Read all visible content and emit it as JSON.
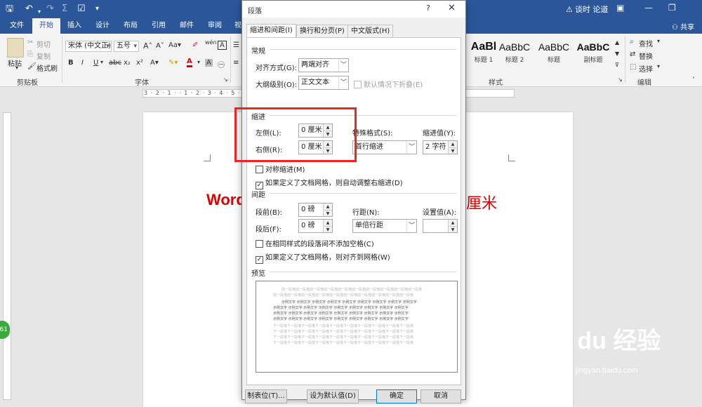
{
  "titlebar": {
    "warning_text": "谈时 论道",
    "share_label": "共享"
  },
  "ribbon": {
    "tabs": [
      "文件",
      "开始",
      "插入",
      "设计",
      "布局",
      "引用",
      "邮件",
      "审阅",
      "视"
    ],
    "clipboard": {
      "paste": "粘贴",
      "cut": "剪切",
      "copy": "复制",
      "painter": "格式刷",
      "group": "剪贴板"
    },
    "font": {
      "name": "宋体 (中文正)",
      "size": "五号",
      "group": "字体",
      "wen": "wén"
    },
    "styles": {
      "items": [
        {
          "preview": "AaBl",
          "name": "标题 1"
        },
        {
          "preview": "AaBbC",
          "name": "标题 2"
        },
        {
          "preview": "AaBbC",
          "name": "标题"
        },
        {
          "preview": "AaBbC",
          "name": "副标题"
        }
      ],
      "group": "样式"
    },
    "editing": {
      "find": "查找",
      "replace": "替换",
      "select": "选择",
      "group": "编辑"
    }
  },
  "ruler": {
    "numbers": "3 · 2 · 1 ·   · 1 · 2 · 3 · 4 · 5 · 6 · 7 · 8 · 9 · 10 · 11 · 12 · 13 · 14 · 15 · 16 · 17 · 18"
  },
  "document": {
    "left_text": "Word",
    "right_text": "厘米",
    "badge": "61"
  },
  "dialog": {
    "title": "段落",
    "help": "?",
    "tabs": [
      "缩进和间距(I)",
      "换行和分页(P)",
      "中文版式(H)"
    ],
    "general": {
      "section": "常规",
      "align_label": "对齐方式(G):",
      "align_value": "两端对齐",
      "outline_label": "大纲级别(O):",
      "outline_value": "正文文本",
      "collapse_label": "默认情况下折叠(E)"
    },
    "indent": {
      "section": "缩进",
      "left_label": "左侧(L):",
      "left_value": "0 厘米",
      "right_label": "右侧(R):",
      "right_value": "0 厘米",
      "special_label": "特殊格式(S):",
      "special_value": "首行缩进",
      "by_label": "缩进值(Y):",
      "by_value": "2 字符",
      "mirror_label": "对称缩进(M)",
      "auto_label": "如果定义了文档网格，则自动调整右缩进(D)"
    },
    "spacing": {
      "section": "间距",
      "before_label": "段前(B):",
      "before_value": "0 磅",
      "after_label": "段后(F):",
      "after_value": "0 磅",
      "line_label": "行距(N):",
      "line_value": "单倍行距",
      "at_label": "设置值(A):",
      "at_value": "",
      "no_space_label": "在相同样式的段落间不添加空格(C)",
      "snap_label": "如果定义了文档网格，则对齐到网格(W)"
    },
    "preview": {
      "section": "预览",
      "prev_para": "前一段落前一段落前一段落前一段落前一段落前一段落前一段落前一段落前一段落前一段落",
      "sample": "示例文字 示例文字 示例文字 示例文字 示例文字 示例文字 示例文字 示例文字 示例文字",
      "next_para": "下一段落下一段落下一段落下一段落下一段落下一段落下一段落下一段落下一段落下一段落"
    },
    "buttons": {
      "tabs": "制表位(T)...",
      "default": "设为默认值(D)",
      "ok": "确定",
      "cancel": "取消"
    }
  },
  "watermark": {
    "logo": "Bai du 经验",
    "url": "jingyan.baidu.com"
  },
  "colors": {
    "word_blue": "#2b579a",
    "doc_text_red": "#e00000",
    "highlight_red": "#ec2424"
  }
}
